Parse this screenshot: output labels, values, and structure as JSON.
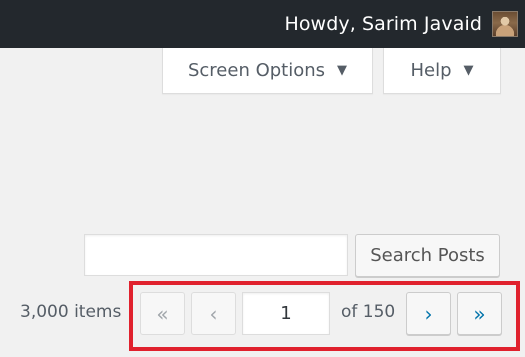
{
  "adminbar": {
    "greeting": "Howdy, Sarim Javaid",
    "avatar_icon": "user-avatar"
  },
  "screen_meta": {
    "screen_options_label": "Screen Options",
    "help_label": "Help",
    "arrow_glyph": "▼"
  },
  "search": {
    "value": "",
    "button_label": "Search Posts"
  },
  "pagination": {
    "items_count": "3,000 items",
    "first_glyph": "«",
    "prev_glyph": "‹",
    "current_page": "1",
    "of_text": "of 150",
    "next_glyph": "›",
    "last_glyph": "»"
  },
  "colors": {
    "adminbar_bg": "#23282d",
    "page_bg": "#f1f1f1",
    "highlight_border": "#e0212d",
    "link_blue": "#0073aa"
  }
}
